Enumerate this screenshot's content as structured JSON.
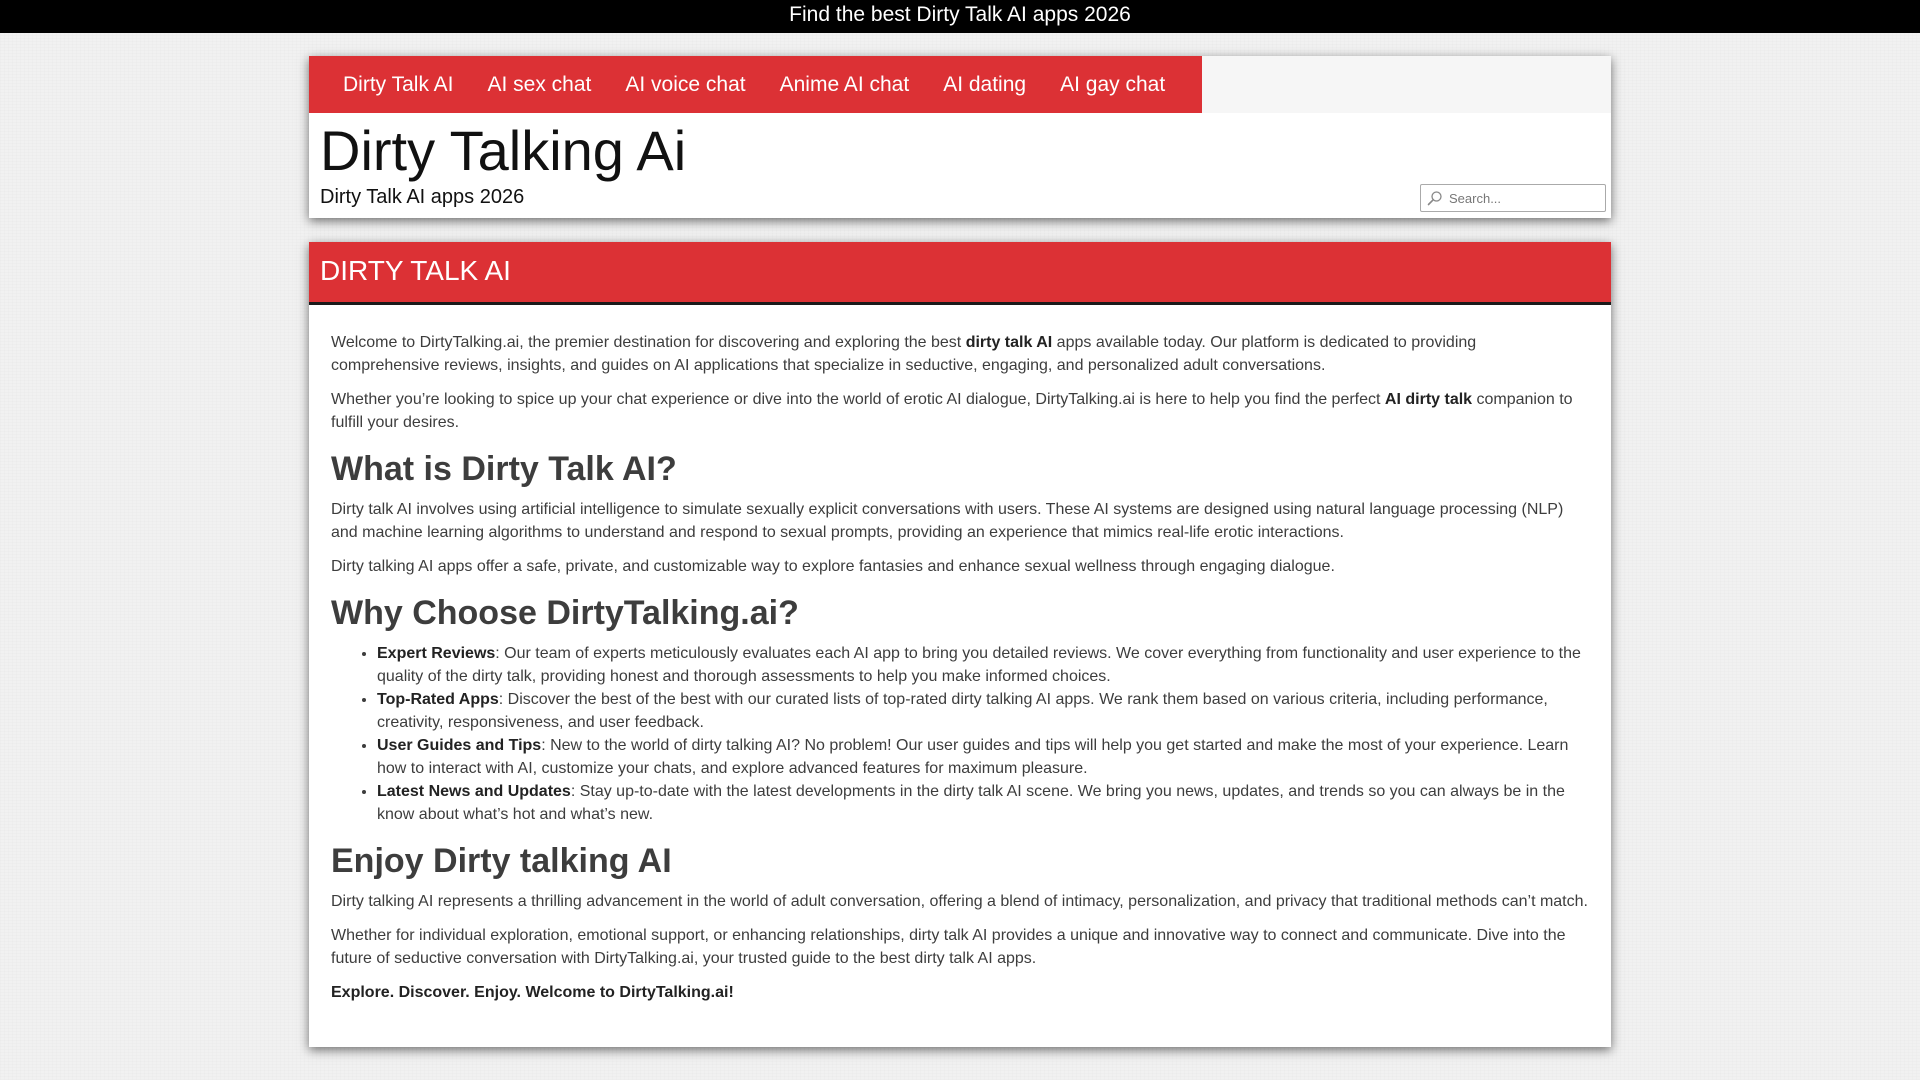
{
  "topbar": {
    "text": "Find the best Dirty Talk AI apps 2026"
  },
  "nav": {
    "items": [
      {
        "label": "Dirty Talk AI"
      },
      {
        "label": "AI sex chat"
      },
      {
        "label": "AI voice chat"
      },
      {
        "label": "Anime AI chat"
      },
      {
        "label": "AI dating"
      },
      {
        "label": "AI gay chat"
      }
    ]
  },
  "site": {
    "title": "Dirty Talking Ai",
    "tagline": "Dirty Talk AI apps 2026"
  },
  "search": {
    "placeholder": "Search...",
    "icon": "search-icon"
  },
  "colors": {
    "accent": "#dc3135",
    "topbar": "#000000",
    "text": "#3d3d3d"
  },
  "page": {
    "heading": "DIRTY TALK AI",
    "intro1": {
      "a": "Welcome to DirtyTalking.ai, the premier destination for discovering and exploring the best ",
      "b": "dirty talk AI",
      "c": " apps available today. Our platform is dedicated to providing comprehensive reviews, insights, and guides on AI applications that specialize in seductive, engaging, and personalized adult conversations."
    },
    "intro2": {
      "a": "Whether you’re looking to spice up your chat experience or dive into the world of erotic AI dialogue, DirtyTalking.ai is here to help you find the perfect ",
      "b": "AI dirty talk",
      "c": " companion to fulfill your desires."
    },
    "h_what": "What is Dirty Talk AI?",
    "what1": "Dirty talk AI involves using artificial intelligence to simulate sexually explicit conversations with users. These AI systems are designed using natural language processing (NLP) and machine learning algorithms to understand and respond to sexual prompts, providing an experience that mimics real-life erotic interactions.",
    "what2": "Dirty talking AI apps offer a safe, private, and customizable way to explore fantasies and enhance sexual wellness through engaging dialogue.",
    "h_why": "Why Choose DirtyTalking.ai?",
    "why_items": [
      {
        "title": "Expert Reviews",
        "text": ": Our team of experts meticulously evaluates each AI app to bring you detailed reviews. We cover everything from functionality and user experience to the quality of the dirty talk, providing honest and thorough assessments to help you make informed choices."
      },
      {
        "title": "Top-Rated Apps",
        "text": ": Discover the best of the best with our curated lists of top-rated dirty talking AI apps. We rank them based on various criteria, including performance, creativity, responsiveness, and user feedback."
      },
      {
        "title": "User Guides and Tips",
        "text": ": New to the world of dirty talking AI? No problem! Our user guides and tips will help you get started and make the most of your experience. Learn how to interact with AI, customize your chats, and explore advanced features for maximum pleasure."
      },
      {
        "title": "Latest News and Updates",
        "text": ": Stay up-to-date with the latest developments in the dirty talk AI scene. We bring you news, updates, and trends so you can always be in the know about what’s hot and what’s new."
      }
    ],
    "h_enjoy": "Enjoy Dirty talking AI",
    "enjoy1": "Dirty talking AI represents a thrilling advancement in the world of adult conversation, offering a blend of intimacy, personalization, and privacy that traditional methods can’t match.",
    "enjoy2": "Whether for individual exploration, emotional support, or enhancing relationships, dirty talk AI provides a unique and innovative way to connect and communicate. Dive into the future of seductive conversation with DirtyTalking.ai, your trusted guide to the best dirty talk AI apps.",
    "closing": "Explore. Discover. Enjoy. Welcome to DirtyTalking.ai!"
  }
}
